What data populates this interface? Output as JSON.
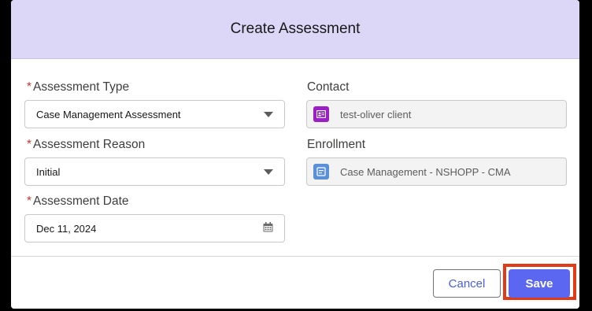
{
  "dialog": {
    "title": "Create Assessment"
  },
  "form": {
    "assessment_type": {
      "label": "Assessment Type",
      "required_mark": "*",
      "value": "Case Management Assessment"
    },
    "assessment_reason": {
      "label": "Assessment Reason",
      "required_mark": "*",
      "value": "Initial"
    },
    "assessment_date": {
      "label": "Assessment Date",
      "required_mark": "*",
      "value": "Dec 11, 2024"
    },
    "contact": {
      "label": "Contact",
      "value": "test-oliver client",
      "icon": "contact-card-icon",
      "icon_color": "#9b1fc4"
    },
    "enrollment": {
      "label": "Enrollment",
      "value": "Case Management - NSHOPP - CMA",
      "icon": "record-icon",
      "icon_color": "#5b8fd6"
    }
  },
  "footer": {
    "cancel_label": "Cancel",
    "save_label": "Save"
  },
  "colors": {
    "header_bg": "#dcd6f7",
    "primary": "#5b67f0",
    "highlight": "#e23a16"
  }
}
